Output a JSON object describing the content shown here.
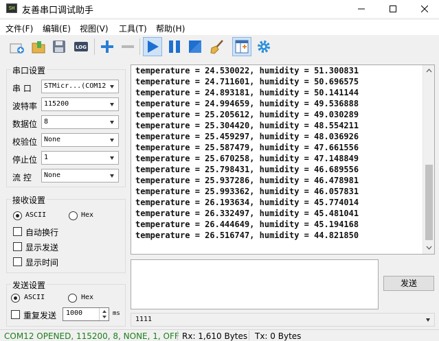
{
  "window": {
    "title": "友善串口调试助手",
    "app_icon_text": "SH",
    "controls": [
      "minimize-icon",
      "maximize-icon",
      "close-icon"
    ]
  },
  "menu": {
    "items": [
      "文件(F)",
      "编辑(E)",
      "视图(V)",
      "工具(T)",
      "帮助(H)"
    ]
  },
  "toolbar": {
    "icons": [
      "new-icon",
      "open-icon",
      "save-icon",
      "log-icon",
      "add-icon",
      "remove-icon",
      "run-icon",
      "pause-icon",
      "stop-icon",
      "clear-broom-icon",
      "layout-icon",
      "settings-gear-icon"
    ],
    "log_label": "LOG"
  },
  "serial_settings": {
    "title": "串口设置",
    "fields": [
      {
        "label": "串  口",
        "value": "STMicr...(COM12"
      },
      {
        "label": "波特率",
        "value": "115200"
      },
      {
        "label": "数据位",
        "value": "8"
      },
      {
        "label": "校验位",
        "value": "None"
      },
      {
        "label": "停止位",
        "value": "1"
      },
      {
        "label": "流  控",
        "value": "None"
      }
    ]
  },
  "receive_settings": {
    "title": "接收设置",
    "radio_ascii": "ASCII",
    "radio_hex": "Hex",
    "selected": "ASCII",
    "checks": [
      "自动换行",
      "显示发送",
      "显示时间"
    ]
  },
  "send_settings": {
    "title": "发送设置",
    "radio_ascii": "ASCII",
    "radio_hex": "Hex",
    "selected": "ASCII",
    "repeat_label": "重复发送",
    "interval": "1000",
    "unit": "ms"
  },
  "receive": {
    "lines": [
      "temperature = 24.530022, humidity = 51.300831",
      "temperature = 24.711601, humidity = 50.696575",
      "temperature = 24.893181, humidity = 50.141144",
      "temperature = 24.994659, humidity = 49.536888",
      "temperature = 25.205612, humidity = 49.030289",
      "temperature = 25.304420, humidity = 48.554211",
      "temperature = 25.459297, humidity = 48.036926",
      "temperature = 25.587479, humidity = 47.661556",
      "temperature = 25.670258, humidity = 47.148849",
      "temperature = 25.798431, humidity = 46.689556",
      "temperature = 25.937286, humidity = 46.478981",
      "temperature = 25.993362, humidity = 46.057831",
      "temperature = 26.193634, humidity = 45.774014",
      "temperature = 26.332497, humidity = 45.481041",
      "temperature = 26.444649, humidity = 45.194168",
      "temperature = 26.516747, humidity = 44.821850"
    ]
  },
  "send": {
    "button_label": "发送",
    "history_value": "1111"
  },
  "status": {
    "port": "COM12 OPENED, 115200, 8, NONE, 1, OFF",
    "rx": "Rx: 1,610 Bytes",
    "tx": "Tx: 0 Bytes",
    "port_color": "#1a7f1a"
  }
}
